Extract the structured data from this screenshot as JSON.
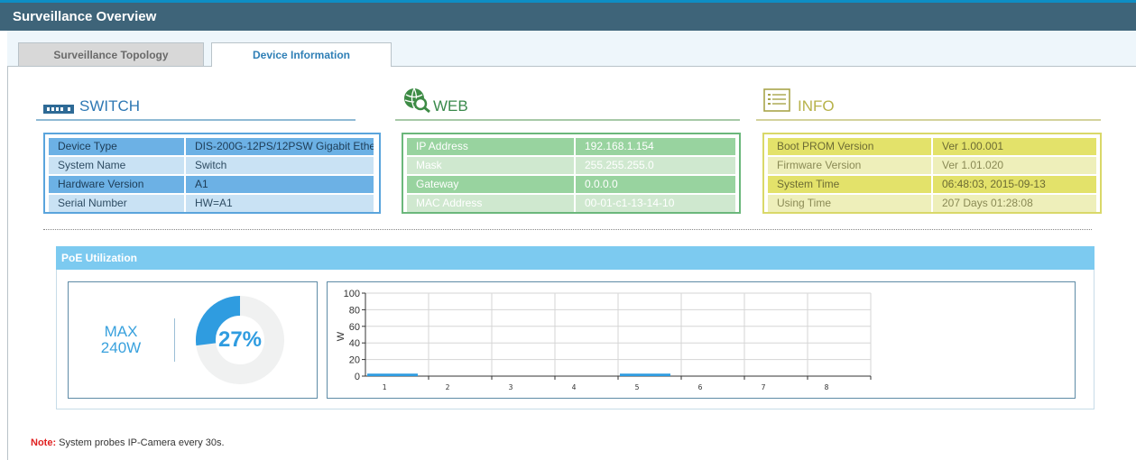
{
  "window": {
    "title": "Surveillance Overview"
  },
  "tabs": [
    {
      "label": "Surveillance Topology",
      "active": false
    },
    {
      "label": "Device Information",
      "active": true
    }
  ],
  "switch": {
    "heading": "SWITCH",
    "rows": [
      {
        "key": "Device Type",
        "value": "DIS-200G-12PS/12PSW Gigabit Ethe..."
      },
      {
        "key": "System Name",
        "value": "Switch"
      },
      {
        "key": "Hardware Version",
        "value": "A1"
      },
      {
        "key": "Serial Number",
        "value": "HW=A1"
      }
    ]
  },
  "web": {
    "heading": "WEB",
    "rows": [
      {
        "key": "IP Address",
        "value": "192.168.1.154"
      },
      {
        "key": "Mask",
        "value": "255.255.255.0"
      },
      {
        "key": "Gateway",
        "value": "0.0.0.0"
      },
      {
        "key": "MAC Address",
        "value": "00-01-c1-13-14-10"
      }
    ]
  },
  "info": {
    "heading": "INFO",
    "rows": [
      {
        "key": "Boot PROM Version",
        "value": "Ver 1.00.001"
      },
      {
        "key": "Firmware Version",
        "value": "Ver 1.01.020"
      },
      {
        "key": "System Time",
        "value": "06:48:03, 2015-09-13"
      },
      {
        "key": "Using Time",
        "value": "207 Days 01:28:08"
      }
    ]
  },
  "poe": {
    "title": "PoE Utilization",
    "max_line1": "MAX",
    "max_line2": "240W",
    "percent_label": "27%",
    "percent_value": 27
  },
  "chart_data": {
    "type": "bar",
    "categories": [
      "1",
      "2",
      "3",
      "4",
      "5",
      "6",
      "7",
      "8"
    ],
    "values": [
      3,
      0,
      0,
      0,
      3,
      0,
      0,
      0
    ],
    "ylabel": "W",
    "ylim": [
      0,
      100
    ],
    "yticks": [
      0,
      20,
      40,
      60,
      80,
      100
    ],
    "grid": true
  },
  "note": {
    "label": "Note:",
    "text": " System probes IP-Camera every 30s."
  },
  "colors": {
    "titlebar": "#3e6479",
    "switch_accent": "#5aa4dc",
    "web_accent": "#6bb77b",
    "info_accent": "#d9d869",
    "poe_bar": "#7ccaf0",
    "gauge_fill": "#2f9ce0"
  }
}
